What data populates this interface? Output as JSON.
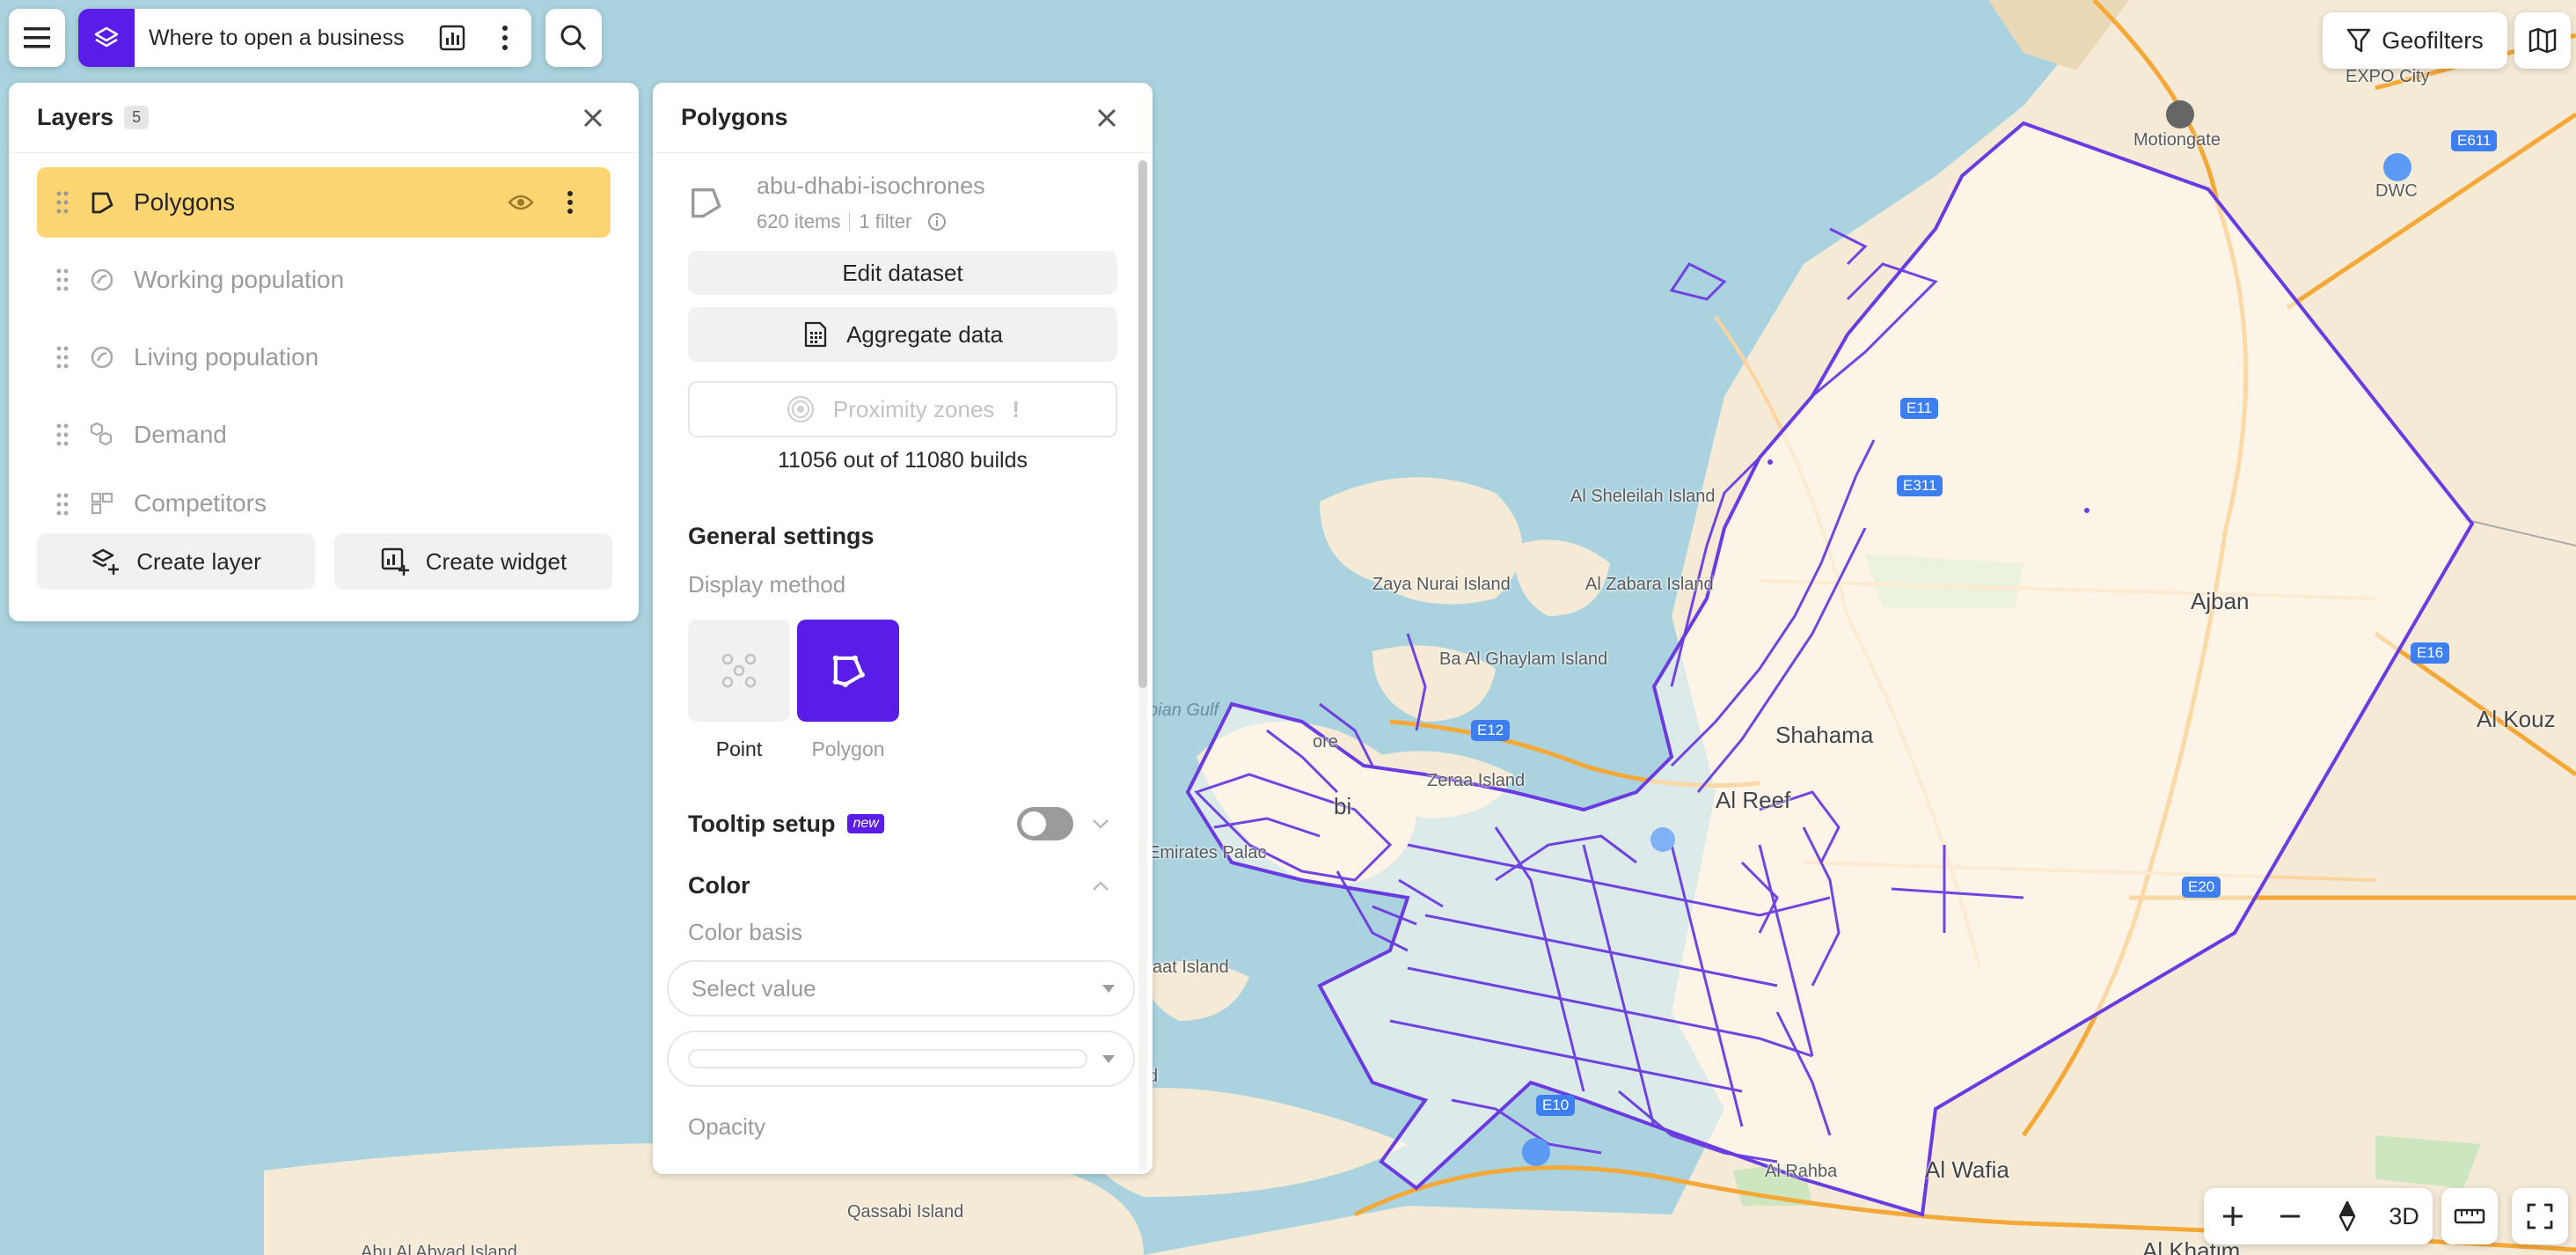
{
  "topbar": {
    "title": "Where to open a business",
    "geofilters_label": "Geofilters"
  },
  "layers_panel": {
    "title": "Layers",
    "count": "5",
    "items": [
      {
        "label": "Polygons",
        "active": true
      },
      {
        "label": "Working population",
        "active": false
      },
      {
        "label": "Living population",
        "active": false
      },
      {
        "label": "Demand",
        "active": false
      },
      {
        "label": "Competitors",
        "active": false
      }
    ],
    "create_layer_label": "Create layer",
    "create_widget_label": "Create widget"
  },
  "polygons_panel": {
    "title": "Polygons",
    "dataset_name": "abu-dhabi-isochrones",
    "items_count": "620 items",
    "filter_count": "1 filter",
    "edit_dataset_label": "Edit dataset",
    "aggregate_label": "Aggregate data",
    "proximity_label": "Proximity zones",
    "proximity_warning": "!",
    "builds_text": "11056 out of 11080 builds",
    "general_settings_title": "General settings",
    "display_method_label": "Display method",
    "methods": [
      {
        "label": "Point",
        "selected": false
      },
      {
        "label": "Polygon",
        "selected": true
      }
    ],
    "tooltip_title": "Tooltip setup",
    "tooltip_badge": "new",
    "color_title": "Color",
    "color_basis_label": "Color basis",
    "color_basis_placeholder": "Select value",
    "opacity_label": "Opacity"
  },
  "map": {
    "labels": {
      "expo_city": "EXPO City",
      "motiongate": "Motiongate",
      "dwc": "DWC",
      "sheleilah": "Al Sheleilah Island",
      "zaya": "Zaya Nurai Island",
      "zabara": "Al Zabara Island",
      "ajban": "Ajban",
      "ba_ghaylam": "Ba Al Ghaylam Island",
      "gulf": "bian Gulf",
      "shahama": "Shahama",
      "zeraa": "Zeraa Island",
      "reef": "Al Reef",
      "emirates_palace": "Emirates Palac",
      "al_kouz": "Al Kouz",
      "saat": "aat Island",
      "wafia": "Al Wafia",
      "rahba": "Al Rahba",
      "qassabi": "Qassabi Island",
      "khatim": "Al Khatim",
      "aldhabi": "Abu Al Abyad Island",
      "bi": "bi",
      "ore": "ore",
      "d": "d"
    },
    "roads": {
      "e611": "E611",
      "e11": "E11",
      "e311": "E311",
      "e12": "E12",
      "e16": "E16",
      "e10": "E10",
      "e20": "E20"
    },
    "accent_color": "#5a1de8",
    "isochrone_color": "#6a3be0"
  },
  "controls": {
    "zoom_in": "+",
    "zoom_out": "−",
    "three_d": "3D"
  }
}
